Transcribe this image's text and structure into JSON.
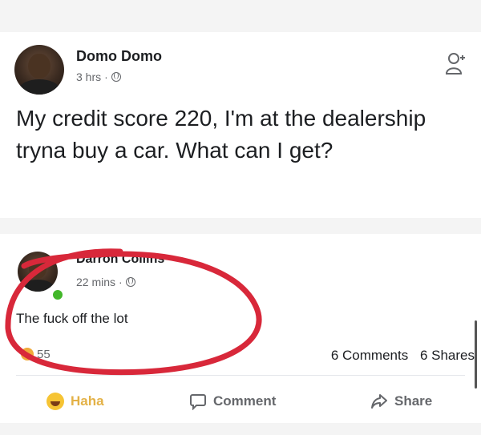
{
  "post": {
    "author": "Domo Domo",
    "time": "3 hrs",
    "separator": "·",
    "text": "My credit score 220, I'm at the dealership tryna buy a car. What can I get?"
  },
  "comment": {
    "author": "Darron Collins",
    "time": "22 mins",
    "separator": "·",
    "text": "The fuck off the lot",
    "reaction_count": "55",
    "comments_count": "6 Comments",
    "shares_count": "6 Shares"
  },
  "actions": {
    "haha": "Haha",
    "comment": "Comment",
    "share": "Share"
  },
  "colors": {
    "annotation": "#d8283a",
    "online": "#42b72a",
    "haha": "#e3b146"
  }
}
